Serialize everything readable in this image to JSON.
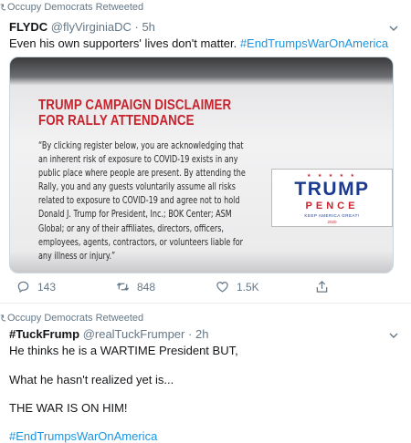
{
  "tweet1": {
    "retweet_label": "Occupy Democrats Retweeted",
    "author_name": "FLYDC",
    "author_handle": "@flyVirginiaDC",
    "separator": "·",
    "time": "5h",
    "text": "Even his own supporters' lives don't matter. ",
    "hashtag": "#EndTrumpsWarOnAmerica",
    "media": {
      "title_lines": [
        "TRUMP CAMPAIGN DISCLAIMER",
        "FOR RALLY ATTENDANCE"
      ],
      "body_lines": [
        "“By clicking register below, you are acknowledging that",
        "an inherent risk of exposure to COVID-19 exists in any",
        "public place where people are present. By attending the",
        "Rally, you and any guests voluntarily assume all risks",
        "related to exposure to COVID-19 and agree not to hold",
        "Donald J. Trump for President, Inc.; BOK Center; ASM",
        "Global; or any of their affiliates, directors, officers,",
        "employees, agents, contractors, or volunteers liable for",
        "any illness or injury.”"
      ],
      "logo": {
        "stars": "★ ★ ★ ★ ★",
        "trump": "TRUMP",
        "pence": "PENCE",
        "slogan": "KEEP AMERICA GREAT!",
        "year": "2020"
      }
    },
    "actions": {
      "reply_count": "143",
      "retweet_count": "848",
      "like_count": "1.5K"
    }
  },
  "tweet2": {
    "retweet_label": "Occupy Democrats Retweeted",
    "author_name": "#TuckFrump",
    "author_handle": "@realTuckFrumper",
    "separator": "·",
    "time": "2h",
    "lines": [
      "He thinks he is a WARTIME President BUT,",
      "What he hasn't realized yet is...",
      "THE WAR IS ON HIM!"
    ],
    "hashtag": "#EndTrumpsWarOnAmerica"
  },
  "colors": {
    "link": "#1b95e0",
    "muted": "#657786",
    "slide_title_red": "#c8232c",
    "logo_blue": "#1a3a8f"
  },
  "icons": [
    "retweet-icon",
    "chevron-down-icon",
    "reply-icon",
    "like-icon",
    "share-icon"
  ]
}
